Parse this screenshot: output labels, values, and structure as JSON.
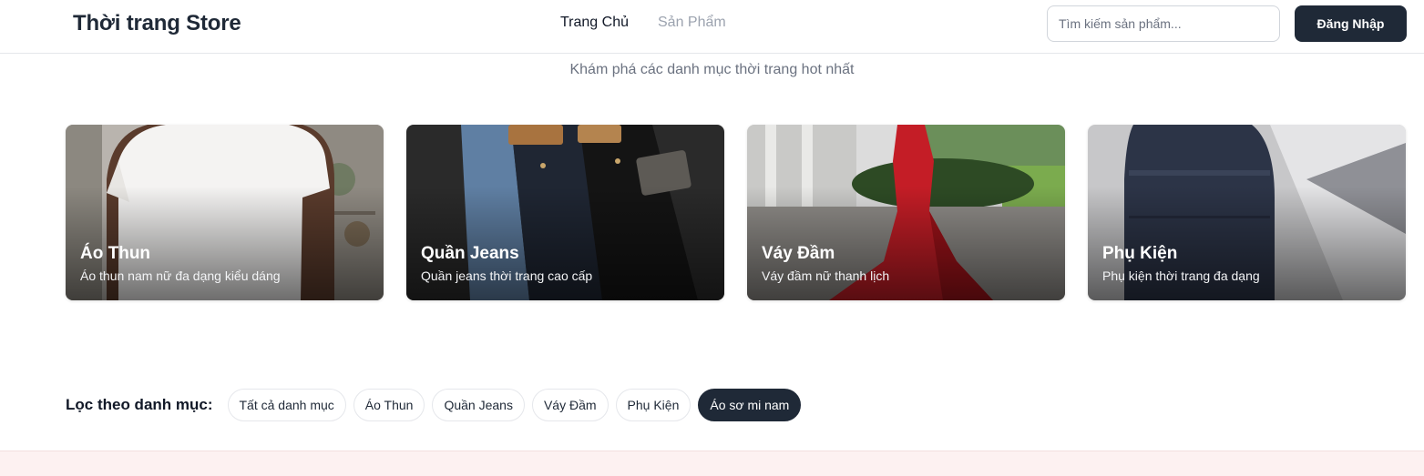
{
  "header": {
    "brand": "Thời trang Store",
    "nav": [
      {
        "label": "Trang Chủ"
      },
      {
        "label": "Sản Phẩm"
      }
    ],
    "search_placeholder": "Tìm kiếm sản phẩm...",
    "login_label": "Đăng Nhập"
  },
  "hero": {
    "subtitle": "Khám phá các danh mục thời trang hot nhất"
  },
  "categories": [
    {
      "title": "Áo Thun",
      "desc": "Áo thun nam nữ đa dạng kiểu dáng",
      "icon": "tshirt-photo"
    },
    {
      "title": "Quần Jeans",
      "desc": "Quần jeans thời trang cao cấp",
      "icon": "jeans-photo"
    },
    {
      "title": "Váy Đầm",
      "desc": "Váy đầm nữ thanh lịch",
      "icon": "dress-photo"
    },
    {
      "title": "Phụ Kiện",
      "desc": "Phụ kiện thời trang đa dạng",
      "icon": "backpack-photo"
    }
  ],
  "filter": {
    "label": "Lọc theo danh mục:",
    "chips": [
      "Tất cả danh mục",
      "Áo Thun",
      "Quần Jeans",
      "Váy Đầm",
      "Phụ Kiện",
      "Áo sơ mi nam"
    ],
    "active_index": 5
  },
  "colors": {
    "primary": "#1f2937",
    "muted_text": "#6b7280",
    "footer_band": "#fdf1f1"
  }
}
